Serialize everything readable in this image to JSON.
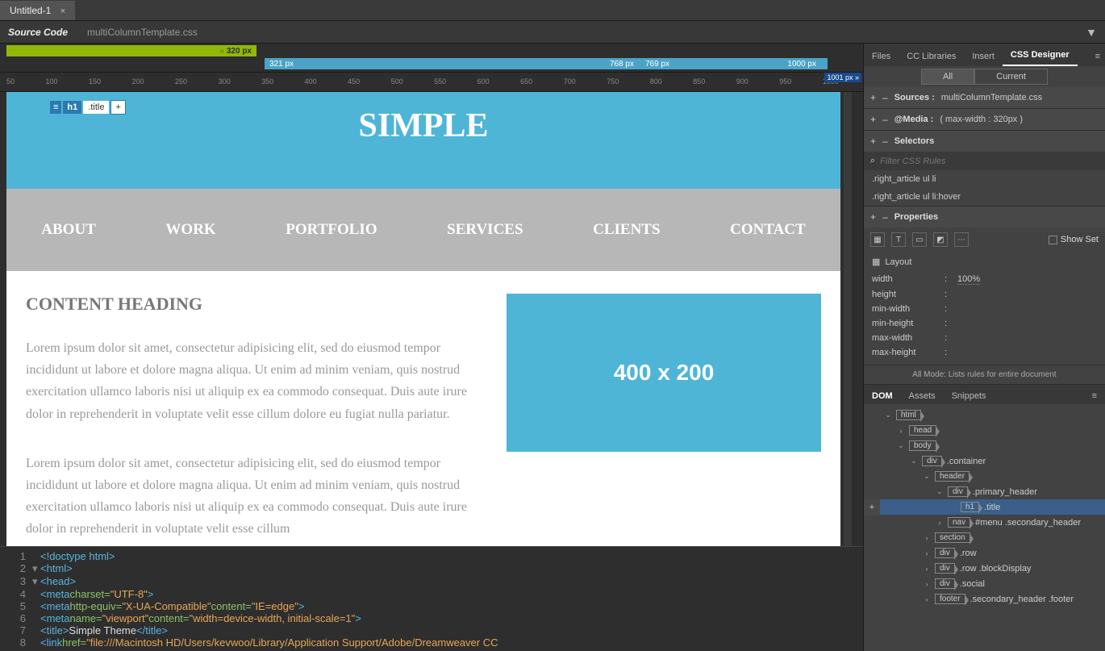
{
  "document": {
    "tab": "Untitled-1",
    "sourceCode": "Source Code",
    "cssFile": "multiColumnTemplate.css"
  },
  "mediaQueries": {
    "green": "320 px",
    "blue": {
      "l1": "321 px",
      "m1": "768 px",
      "m2": "769 px",
      "r": "1000 px"
    },
    "marker": "1001 px"
  },
  "ruler": [
    "50",
    "100",
    "150",
    "200",
    "250",
    "300",
    "350",
    "400",
    "450",
    "500",
    "550",
    "600",
    "650",
    "700",
    "750",
    "800",
    "850",
    "900",
    "950",
    "1000"
  ],
  "selection": {
    "icon": "≡",
    "element": "h1",
    "class": ".title",
    "add": "+"
  },
  "page": {
    "title": "SIMPLE",
    "nav": [
      "ABOUT",
      "WORK",
      "PORTFOLIO",
      "SERVICES",
      "CLIENTS",
      "CONTACT"
    ],
    "heading": "CONTENT HEADING",
    "para1": "Lorem ipsum dolor sit amet, consectetur adipisicing elit, sed do eiusmod tempor incididunt ut labore et dolore magna aliqua. Ut enim ad minim veniam, quis nostrud exercitation ullamco laboris nisi ut aliquip ex ea commodo consequat. Duis aute irure dolor in reprehenderit in voluptate velit esse cillum dolore eu fugiat nulla pariatur.",
    "para2": "Lorem ipsum dolor sit amet, consectetur adipisicing elit, sed do eiusmod tempor incididunt ut labore et dolore magna aliqua. Ut enim ad minim veniam, quis nostrud exercitation ullamco laboris nisi ut aliquip ex ea commodo consequat. Duis aute irure dolor in reprehenderit in voluptate velit esse cillum",
    "placeholder": "400 x 200"
  },
  "code": {
    "l1": "<!doctype html>",
    "l2": "<html>",
    "l3": "<head>",
    "l4a": "<meta",
    "l4b": " charset=",
    "l4c": "\"UTF-8\"",
    "l4d": ">",
    "l5a": "<meta",
    "l5b": " http-equiv=",
    "l5c": "\"X-UA-Compatible\"",
    "l5d": " content=",
    "l5e": "\"IE=edge\"",
    "l5f": ">",
    "l6a": "<meta",
    "l6b": " name=",
    "l6c": "\"viewport\"",
    "l6d": " content=",
    "l6e": "\"width=device-width, initial-scale=1\"",
    "l6f": ">",
    "l7a": "<title>",
    "l7b": "Simple Theme",
    "l7c": "</title>",
    "l8a": "<link",
    "l8b": " href=",
    "l8c": "\"file:///Macintosh HD/Users/kevwoo/Library/Application Support/Adobe/Dreamweaver CC"
  },
  "panels": {
    "tabs": [
      "Files",
      "CC Libraries",
      "Insert",
      "CSS Designer"
    ],
    "allCurrent": [
      "All",
      "Current"
    ],
    "sources": {
      "label": "Sources :",
      "value": "multiColumnTemplate.css"
    },
    "media": {
      "label": "@Media :",
      "value": "( max-width : 320px )"
    },
    "selectors": {
      "label": "Selectors",
      "filter": "Filter CSS Rules",
      "rules": [
        ".right_article ul li",
        ".right_article ul li:hover"
      ]
    },
    "properties": {
      "label": "Properties",
      "showSet": "Show Set",
      "layout": "Layout",
      "rows": [
        {
          "k": "width",
          "v": "100%"
        },
        {
          "k": "height",
          "v": ""
        },
        {
          "k": "min-width",
          "v": ""
        },
        {
          "k": "min-height",
          "v": ""
        },
        {
          "k": "max-width",
          "v": ""
        },
        {
          "k": "max-height",
          "v": ""
        }
      ],
      "modeNote": "All Mode: Lists rules for entire document"
    }
  },
  "dom": {
    "tabs": [
      "DOM",
      "Assets",
      "Snippets"
    ],
    "tree": [
      {
        "ind": 1,
        "tog": "⌄",
        "tag": "html",
        "cls": ""
      },
      {
        "ind": 2,
        "tog": "›",
        "tag": "head",
        "cls": ""
      },
      {
        "ind": 2,
        "tog": "⌄",
        "tag": "body",
        "cls": ""
      },
      {
        "ind": 3,
        "tog": "⌄",
        "tag": "div",
        "cls": ".container"
      },
      {
        "ind": 4,
        "tog": "⌄",
        "tag": "header",
        "cls": ""
      },
      {
        "ind": 5,
        "tog": "⌄",
        "tag": "div",
        "cls": ".primary_header"
      },
      {
        "ind": 6,
        "tog": "",
        "tag": "h1",
        "cls": ".title",
        "sel": true
      },
      {
        "ind": 5,
        "tog": "›",
        "tag": "nav",
        "cls": "#menu .secondary_header"
      },
      {
        "ind": 4,
        "tog": "›",
        "tag": "section",
        "cls": ""
      },
      {
        "ind": 4,
        "tog": "›",
        "tag": "div",
        "cls": ".row"
      },
      {
        "ind": 4,
        "tog": "›",
        "tag": "div",
        "cls": ".row .blockDisplay"
      },
      {
        "ind": 4,
        "tog": "›",
        "tag": "div",
        "cls": ".social"
      },
      {
        "ind": 4,
        "tog": "›",
        "tag": "footer",
        "cls": ".secondary_header .footer"
      }
    ]
  }
}
